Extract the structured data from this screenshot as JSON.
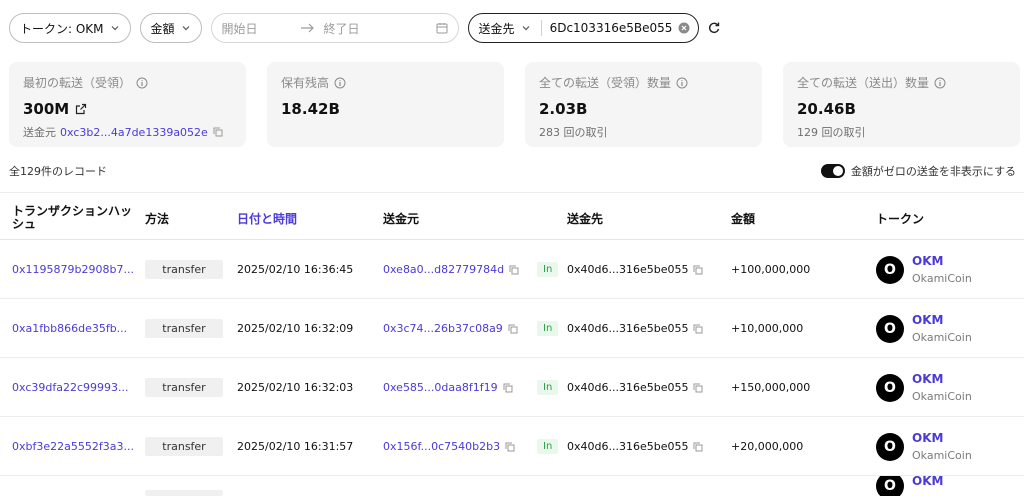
{
  "filters": {
    "token_label": "トークン: OKM",
    "amount_label": "金額",
    "date_start_placeholder": "開始日",
    "date_end_placeholder": "終了日",
    "destination_label": "送金先",
    "destination_value": "6Dc103316e5Be055"
  },
  "cards": [
    {
      "title": "最初の転送（受領）",
      "value": "300M",
      "sub_prefix": "送金元",
      "sub_addr": "0xc3b2...4a7de1339a052e"
    },
    {
      "title": "保有残高",
      "value": "18.42B"
    },
    {
      "title": "全ての転送（受領）数量",
      "value": "2.03B",
      "sub": "283 回の取引"
    },
    {
      "title": "全ての転送（送出）数量",
      "value": "20.46B",
      "sub": "129 回の取引"
    }
  ],
  "meta": {
    "records": "全129件のレコード",
    "toggle_label": "金額がゼロの送金を非表示にする"
  },
  "table": {
    "headers": {
      "hash": "トランザクションハッシュ",
      "method": "方法",
      "date": "日付と時間",
      "from": "送金元",
      "to": "送金先",
      "amount": "金額",
      "token": "トークン"
    },
    "rows": [
      {
        "hash": "0x1195879b2908b7...",
        "method": "transfer",
        "date": "2025/02/10 16:36:45",
        "from": "0xe8a0...d82779784d",
        "dir": "In",
        "to": "0x40d6...316e5be055",
        "amount": "+100,000,000",
        "token_symbol": "OKM",
        "token_name": "OkamiCoin"
      },
      {
        "hash": "0xa1fbb866de35fb...",
        "method": "transfer",
        "date": "2025/02/10 16:32:09",
        "from": "0x3c74...26b37c08a9",
        "dir": "In",
        "to": "0x40d6...316e5be055",
        "amount": "+10,000,000",
        "token_symbol": "OKM",
        "token_name": "OkamiCoin"
      },
      {
        "hash": "0xc39dfa22c99993...",
        "method": "transfer",
        "date": "2025/02/10 16:32:03",
        "from": "0xe585...0daa8f1f19",
        "dir": "In",
        "to": "0x40d6...316e5be055",
        "amount": "+150,000,000",
        "token_symbol": "OKM",
        "token_name": "OkamiCoin"
      },
      {
        "hash": "0xbf3e22a5552f3a3...",
        "method": "transfer",
        "date": "2025/02/10 16:31:57",
        "from": "0x156f...0c7540b2b3",
        "dir": "In",
        "to": "0x40d6...316e5be055",
        "amount": "+20,000,000",
        "token_symbol": "OKM",
        "token_name": "OkamiCoin"
      }
    ],
    "partial_row_token_symbol": "OKM"
  }
}
